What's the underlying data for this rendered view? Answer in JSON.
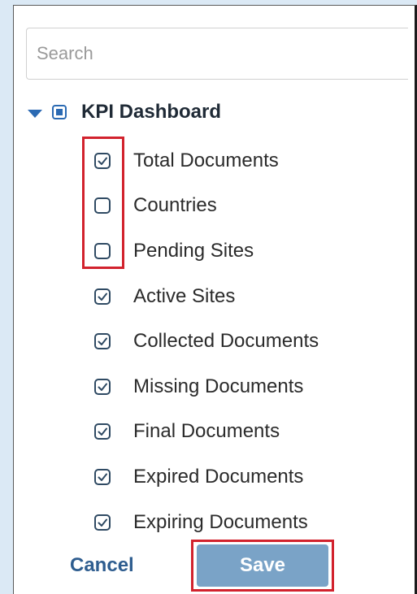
{
  "search": {
    "placeholder": "Search",
    "value": ""
  },
  "tree": {
    "root_label": "KPI Dashboard",
    "root_state": "partial",
    "items": [
      {
        "label": "Total Documents",
        "checked": true
      },
      {
        "label": "Countries",
        "checked": false
      },
      {
        "label": "Pending Sites",
        "checked": false
      },
      {
        "label": "Active Sites",
        "checked": true
      },
      {
        "label": "Collected Documents",
        "checked": true
      },
      {
        "label": "Missing Documents",
        "checked": true
      },
      {
        "label": "Final Documents",
        "checked": true
      },
      {
        "label": "Expired Documents",
        "checked": true
      },
      {
        "label": "Expiring Documents",
        "checked": true
      }
    ]
  },
  "actions": {
    "cancel_label": "Cancel",
    "save_label": "Save"
  },
  "colors": {
    "accent": "#2b6ab3",
    "highlight": "#d2222d",
    "save_bg": "#7aa3c7"
  }
}
